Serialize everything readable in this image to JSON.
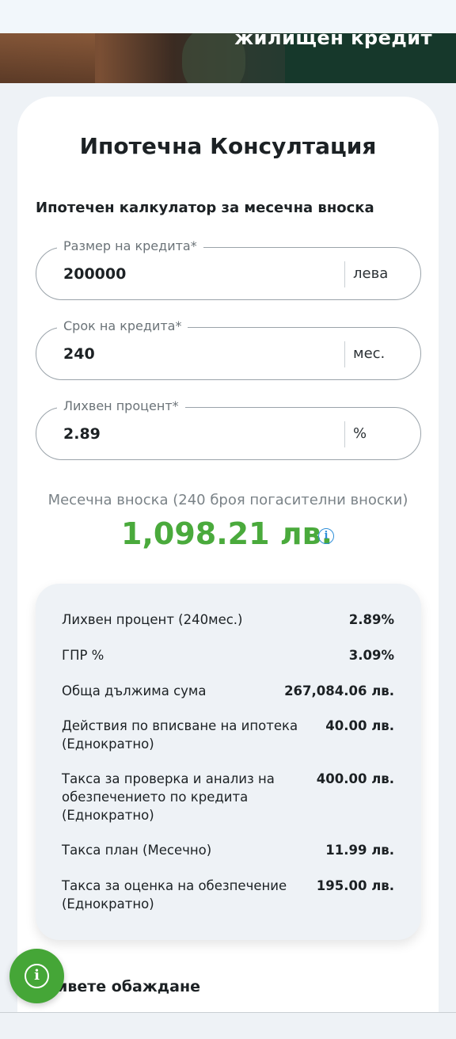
{
  "hero": {
    "title": "жилищен кредит"
  },
  "card": {
    "title": "Ипотечна Консултация",
    "section_title": "Ипотечен калкулатор за месечна вноска"
  },
  "fields": {
    "amount": {
      "label": "Размер на кредита*",
      "value": "200000",
      "unit": "лева"
    },
    "term": {
      "label": "Срок на кредита*",
      "value": "240",
      "unit": "мес."
    },
    "rate": {
      "label": "Лихвен процент*",
      "value": "2.89",
      "unit": "%"
    }
  },
  "result": {
    "label": "Месечна вноска (240 броя погасителни вноски)",
    "value": "1,098.21 лв.",
    "info_icon": "info-icon"
  },
  "details": [
    {
      "label": "Лихвен процент (240мес.)",
      "value": "2.89%"
    },
    {
      "label": "ГПР %",
      "value": "3.09%"
    },
    {
      "label": "Обща дължима сума",
      "value": "267,084.06 лв."
    },
    {
      "label": "Действия по вписване на ипотека (Еднократно)",
      "value": "40.00 лв."
    },
    {
      "label": "Такса за проверка и анализ на обезпечението по кредита (Еднократно)",
      "value": "400.00 лв."
    },
    {
      "label": "Такса план (Месечно)",
      "value": "11.99 лв."
    },
    {
      "label": "Такса за оценка на обезпечение (Еднократно)",
      "value": "195.00 лв."
    }
  ],
  "callback": {
    "title": "ивете обаждане"
  },
  "fab": {
    "icon": "info-icon",
    "color": "#45a637"
  },
  "colors": {
    "accent": "#4aaa3c",
    "info": "#2f8fd8"
  }
}
